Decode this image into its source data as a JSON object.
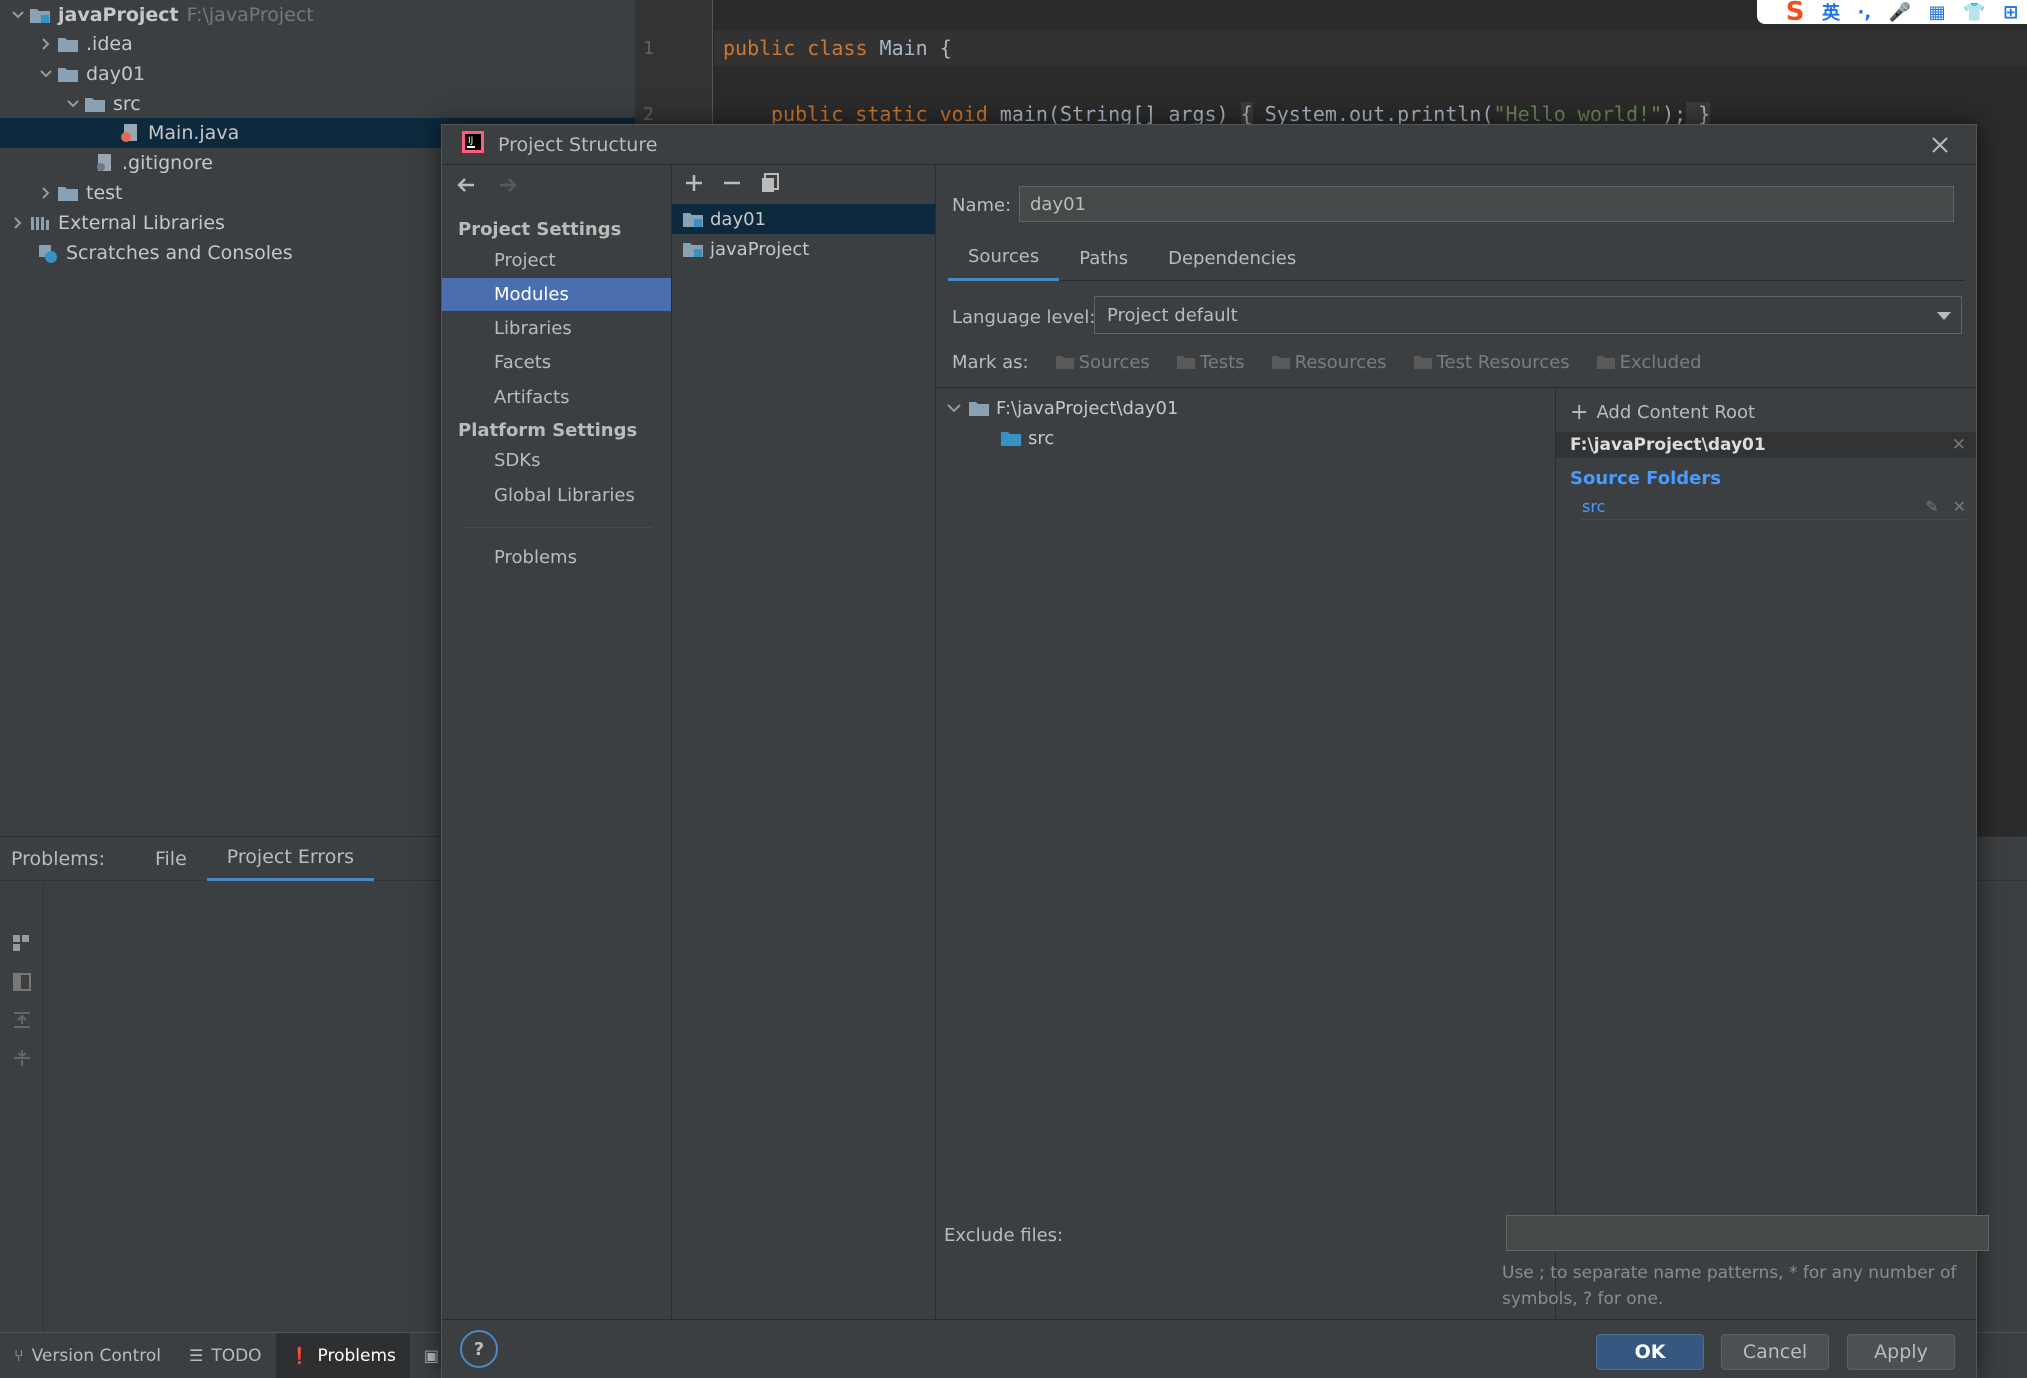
{
  "project_tree": {
    "root": {
      "name": "javaProject",
      "path": "F:\\javaProject"
    },
    "items": [
      {
        "label": ".idea"
      },
      {
        "label": "day01"
      },
      {
        "label": "src"
      },
      {
        "label": "Main.java"
      },
      {
        "label": ".gitignore"
      },
      {
        "label": "test"
      },
      {
        "label": "External Libraries"
      },
      {
        "label": "Scratches and Consoles"
      }
    ]
  },
  "editor": {
    "line_numbers": [
      "1",
      "2"
    ],
    "line1": {
      "kw": "public class",
      "rest": " Main {"
    },
    "line2": {
      "kw": "public static void",
      "sig": " main(String[] args) ",
      "fold_open": "{",
      "call": " System.out.println(",
      "str": "\"Hello world!\"",
      "end": ");",
      "fold_close": " }"
    }
  },
  "ime": {
    "logo": "S",
    "items": [
      "英",
      "·,",
      "🎤",
      "▦",
      "👕",
      "⊞"
    ]
  },
  "problems": {
    "title": "Problems:",
    "tabs": [
      {
        "label": "File"
      },
      {
        "label": "Project Errors"
      }
    ]
  },
  "statusbar": {
    "items": [
      {
        "label": "Version Control",
        "icon": "branch-icon"
      },
      {
        "label": "TODO",
        "icon": "list-icon"
      },
      {
        "label": "Problems",
        "icon": "warning-icon"
      }
    ]
  },
  "dialog": {
    "title": "Project Structure",
    "project_settings_title": "Project Settings",
    "project_settings_items": [
      "Project",
      "Modules",
      "Libraries",
      "Facets",
      "Artifacts"
    ],
    "platform_settings_title": "Platform Settings",
    "platform_settings_items": [
      "SDKs",
      "Global Libraries"
    ],
    "problems_item": "Problems",
    "selected_nav": "Modules",
    "modules": [
      "day01",
      "javaProject"
    ],
    "name_label": "Name:",
    "name_value": "day01",
    "tabs": [
      "Sources",
      "Paths",
      "Dependencies"
    ],
    "active_tab": "Sources",
    "language_level_label": "Language level:",
    "language_level_value": "Project default",
    "mark_as_label": "Mark as:",
    "mark_as_items": [
      "Sources",
      "Tests",
      "Resources",
      "Test Resources",
      "Excluded"
    ],
    "content_tree": {
      "root": "F:\\javaProject\\day01",
      "child": "src"
    },
    "exclude_files_label": "Exclude files:",
    "exclude_hint": "Use ; to separate name patterns, * for any number of symbols, ? for one.",
    "add_content_root": "Add Content Root",
    "content_root_header": "F:\\javaProject\\day01",
    "source_folders_title": "Source Folders",
    "source_folder": "src",
    "buttons": {
      "ok": "OK",
      "cancel": "Cancel",
      "apply": "Apply",
      "help": "?"
    }
  },
  "colors": {
    "selection_accent": "#4b6eaf",
    "tab_underline": "#4a88c7",
    "source_folder_blue": "#4a9bff",
    "keyword_orange": "#cc7832",
    "string_green": "#6a8759"
  }
}
